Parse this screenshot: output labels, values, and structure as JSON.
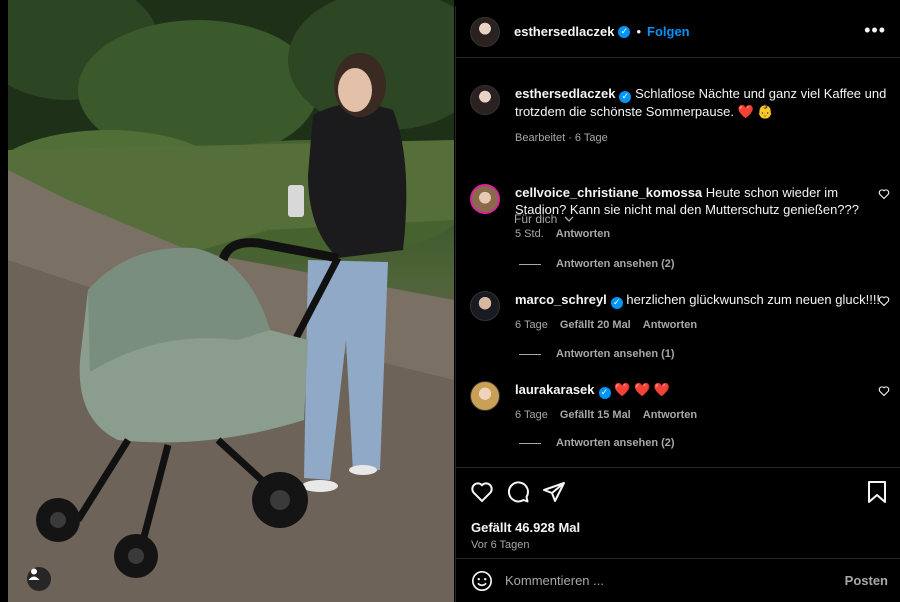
{
  "post": {
    "author": "esthersedlaczek",
    "follow_label": "Folgen",
    "separator": "•",
    "more_label": "•••",
    "caption_text": "Schlaflose Nächte und ganz viel Kaffee und trotzdem die schönste Sommerpause.",
    "caption_emojis": "❤️ 👶",
    "caption_meta": "Bearbeitet · 6 Tage",
    "for_you_label": "Für dich"
  },
  "comments": [
    {
      "username": "cellvoice_christiane_komossa",
      "text": "Heute schon wieder im Stadion? Kann sie nicht mal den Mutterschutz genießen???",
      "time": "5 Std.",
      "likes": "",
      "reply_label": "Antworten",
      "view_replies": "Antworten ansehen (2)"
    },
    {
      "username": "marco_schreyl",
      "verified": true,
      "text": "herzlichen glückwunsch zum neuen gluck!!!!",
      "time": "6 Tage",
      "likes": "Gefällt 20 Mal",
      "reply_label": "Antworten",
      "view_replies": "Antworten ansehen (1)"
    },
    {
      "username": "laurakarasek",
      "verified": true,
      "text": "❤️ ❤️ ❤️",
      "time": "6 Tage",
      "likes": "Gefällt 15 Mal",
      "reply_label": "Antworten",
      "view_replies": "Antworten ansehen (2)"
    }
  ],
  "actions": {
    "likes_count": "Gefällt 46.928 Mal",
    "posted_ago": "Vor 6 Tagen"
  },
  "composer": {
    "placeholder": "Kommentieren ...",
    "post_label": "Posten"
  },
  "icons": [
    "heart-icon",
    "comment-icon",
    "share-icon",
    "bookmark-icon",
    "emoji-icon",
    "user-tag-icon",
    "verified-icon"
  ],
  "colors": {
    "accent": "#0095f6",
    "secondary_text": "#a8a8a8",
    "background": "#000000"
  }
}
